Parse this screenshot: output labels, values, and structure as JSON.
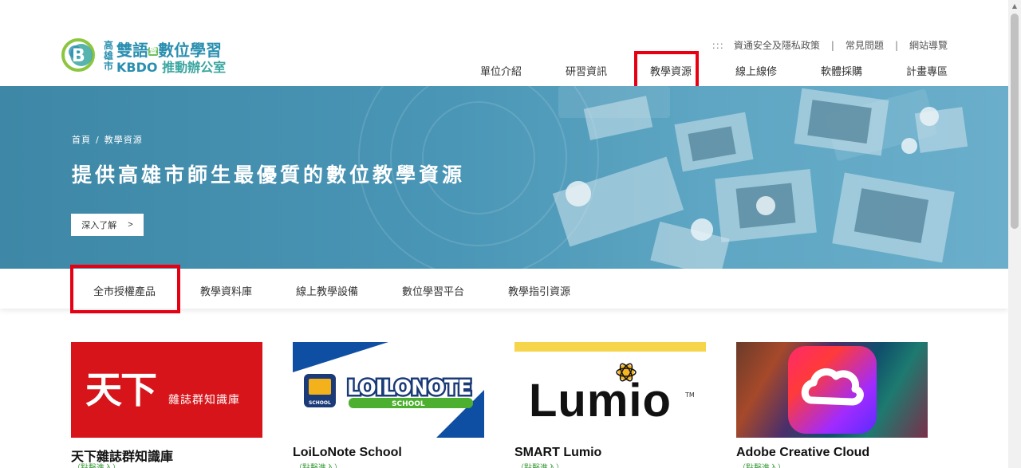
{
  "logo": {
    "side_text": "高雄市",
    "top_line_a": "雙語",
    "top_badge": "暨",
    "top_line_b": "數位學習",
    "bottom_en": "KBDO",
    "bottom_zh": "推動辦公室"
  },
  "utility_nav": {
    "dots": ":::",
    "items": [
      "資通安全及隱私政策",
      "常見問題",
      "網站導覽"
    ],
    "separator": "|"
  },
  "main_nav": [
    "單位介紹",
    "研習資訊",
    "教學資源",
    "線上線修",
    "軟體採購",
    "計畫專區"
  ],
  "banner": {
    "breadcrumb": [
      "首頁",
      "教學資源"
    ],
    "breadcrumb_sep": "/",
    "title": "提供高雄市師生最優質的數位教學資源",
    "more_label": "深入了解",
    "more_arrow": ">"
  },
  "sub_tabs": [
    "全市授權產品",
    "教學資料庫",
    "線上教學設備",
    "數位學習平台",
    "教學指引資源"
  ],
  "cards": [
    {
      "title": "天下雜誌群知識庫",
      "link": "（點擊進入）",
      "img_big": "天下",
      "img_small": "雜誌群知識庫"
    },
    {
      "title": "LoiLoNote School",
      "link": "（點擊進入）",
      "img_word": "LOILONOTE",
      "img_sub": "SCHOOL"
    },
    {
      "title": "SMART Lumio",
      "link": "（點擊進入）",
      "img_word": "Lumio",
      "img_tm": "TM"
    },
    {
      "title": "Adobe Creative Cloud",
      "link": "（點擊進入）"
    }
  ],
  "colors": {
    "highlight": "#e60012",
    "banner": "#4a96b6",
    "brand_blue": "#2a8fb0",
    "link_green": "#3a9b3a",
    "tianxia_red": "#d7141a"
  },
  "icons": [
    "kbdo-logo-icon",
    "chevron-right-icon",
    "scroll-up-icon"
  ]
}
